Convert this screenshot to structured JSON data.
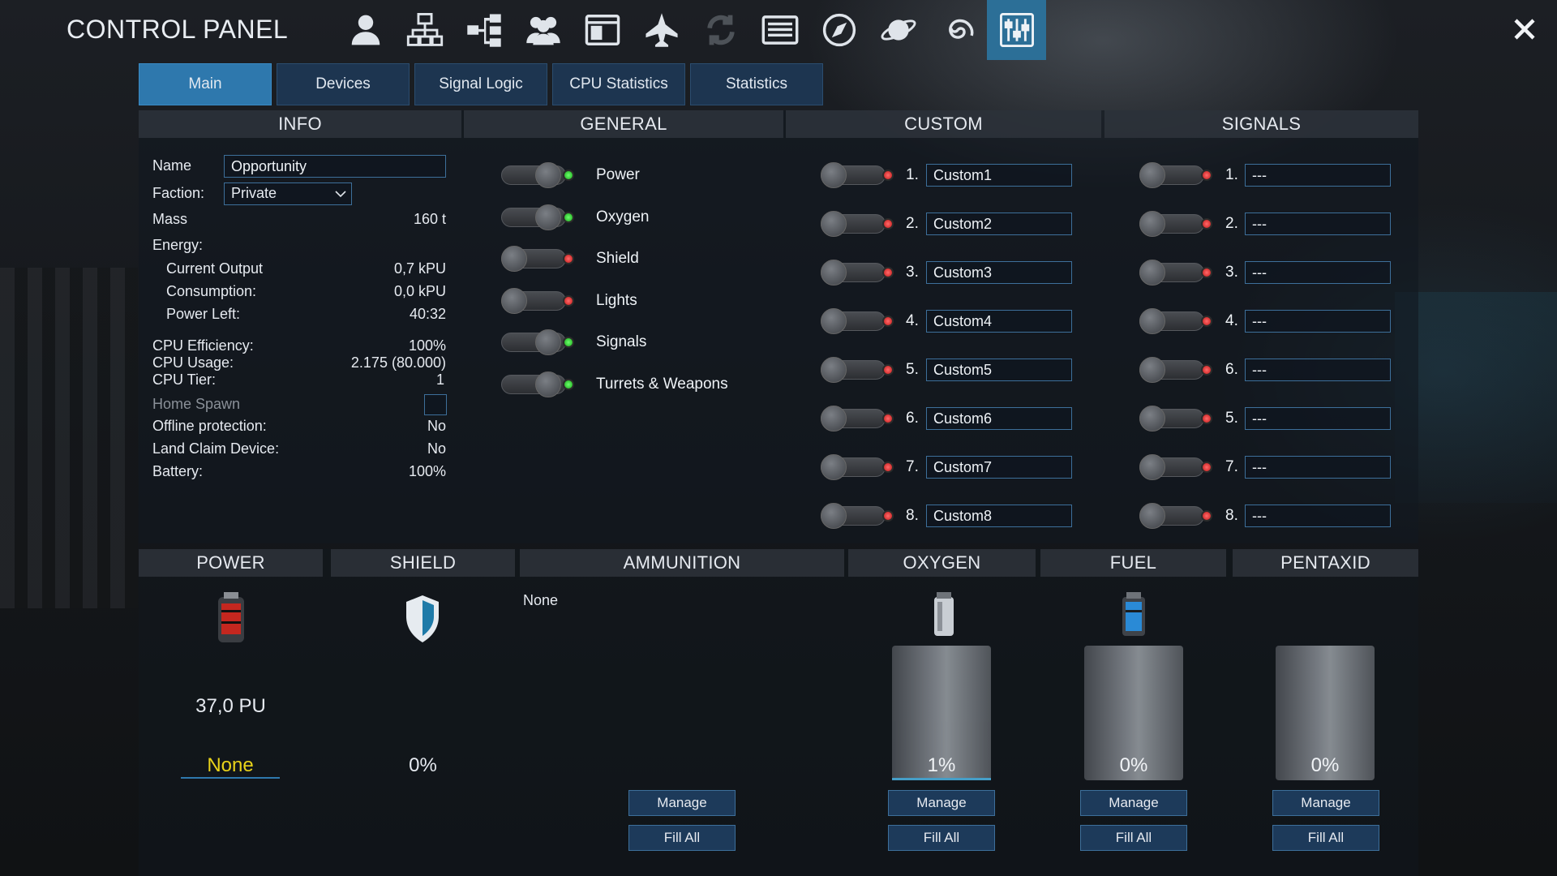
{
  "title": "CONTROL PANEL",
  "toolbar_icons": [
    "user-icon",
    "network-icon",
    "tree-icon",
    "group-icon",
    "window-icon",
    "ship-icon",
    "refresh-icon",
    "list-icon",
    "compass-icon",
    "planet-icon",
    "galaxy-icon",
    "control-panel-icon"
  ],
  "tabs": [
    "Main",
    "Devices",
    "Signal Logic",
    "CPU Statistics",
    "Statistics"
  ],
  "active_tab": "Main",
  "info": {
    "header": "INFO",
    "name_label": "Name",
    "name_value": "Opportunity",
    "faction_label": "Faction:",
    "faction_value": "Private",
    "mass_label": "Mass",
    "mass_value": "160 t",
    "energy_label": "Energy:",
    "output_label": "Current Output",
    "output_value": "0,7 kPU",
    "consumption_label": "Consumption:",
    "consumption_value": "0,0 kPU",
    "powerleft_label": "Power Left:",
    "powerleft_value": "40:32",
    "cpu_eff_label": "CPU Efficiency:",
    "cpu_eff_value": "100%",
    "cpu_usage_label": "CPU Usage:",
    "cpu_usage_value": "2.175  (80.000)",
    "cpu_tier_label": "CPU Tier:",
    "cpu_tier_value": "1",
    "home_spawn_label": "Home Spawn",
    "offline_label": "Offline protection:",
    "offline_value": "No",
    "landclaim_label": "Land Claim Device:",
    "landclaim_value": "No",
    "battery_label": "Battery:",
    "battery_value": "100%"
  },
  "general": {
    "header": "GENERAL",
    "items": [
      {
        "label": "Power",
        "on": true
      },
      {
        "label": "Oxygen",
        "on": true
      },
      {
        "label": "Shield",
        "on": false
      },
      {
        "label": "Lights",
        "on": false
      },
      {
        "label": "Signals",
        "on": true
      },
      {
        "label": "Turrets & Weapons",
        "on": true
      }
    ]
  },
  "custom": {
    "header": "CUSTOM",
    "items": [
      {
        "num": "1.",
        "value": "Custom1"
      },
      {
        "num": "2.",
        "value": "Custom2"
      },
      {
        "num": "3.",
        "value": "Custom3"
      },
      {
        "num": "4.",
        "value": "Custom4"
      },
      {
        "num": "5.",
        "value": "Custom5"
      },
      {
        "num": "6.",
        "value": "Custom6"
      },
      {
        "num": "7.",
        "value": "Custom7"
      },
      {
        "num": "8.",
        "value": "Custom8"
      }
    ]
  },
  "signals": {
    "header": "SIGNALS",
    "items": [
      {
        "num": "1.",
        "value": "---"
      },
      {
        "num": "2.",
        "value": "---"
      },
      {
        "num": "3.",
        "value": "---"
      },
      {
        "num": "4.",
        "value": "---"
      },
      {
        "num": "6.",
        "value": "---"
      },
      {
        "num": "5.",
        "value": "---"
      },
      {
        "num": "7.",
        "value": "---"
      },
      {
        "num": "8.",
        "value": "---"
      }
    ]
  },
  "resources": {
    "power": {
      "header": "POWER",
      "value": "37,0 PU",
      "status": "None"
    },
    "shield": {
      "header": "SHIELD",
      "value": "0%"
    },
    "ammunition": {
      "header": "AMMUNITION",
      "value": "None"
    },
    "oxygen": {
      "header": "OXYGEN",
      "percent": "1%",
      "fill": 0.01
    },
    "fuel": {
      "header": "FUEL",
      "percent": "0%",
      "fill": 0
    },
    "pentaxid": {
      "header": "PENTAXID",
      "percent": "0%",
      "fill": 0
    },
    "manage_label": "Manage",
    "fill_all_label": "Fill All"
  },
  "colors": {
    "accent": "#2e78ad",
    "status_yellow": "#e8d21a",
    "led_on": "#2ecc2e",
    "led_off": "#e02020"
  }
}
